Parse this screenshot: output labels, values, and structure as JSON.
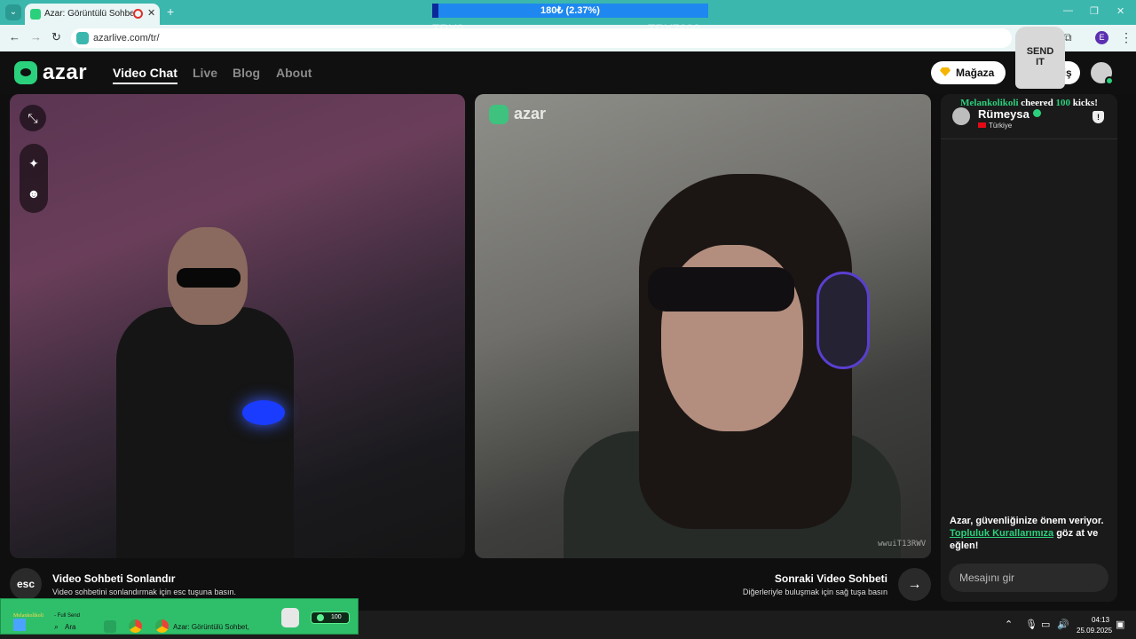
{
  "browser": {
    "tab_title": "Azar: Görüntülü Sohbet, Ar",
    "url": "azarlive.com/tr/",
    "profile_initial": "E"
  },
  "overlay": {
    "progress_text": "180₺ (2.37%)",
    "progress_fraction": 0.0237,
    "left_label": "TRY0",
    "right_label": "TRY7600"
  },
  "site": {
    "logo": "azar",
    "nav": [
      {
        "label": "Video Chat",
        "active": true
      },
      {
        "label": "Live",
        "active": false
      },
      {
        "label": "Blog",
        "active": false
      },
      {
        "label": "About",
        "active": false
      }
    ],
    "shop_label": "Mağaza",
    "premium_label_partial": "miş"
  },
  "sticker": {
    "line1": "SEND",
    "line2": "IT"
  },
  "video": {
    "watermark": "azar",
    "partner_id": "wwuiT13RWV"
  },
  "chat": {
    "cheer_name": "Melankolikoli",
    "cheer_text": "cheered",
    "cheer_amount": "100",
    "cheer_suffix": "kicks!",
    "partner_name": "Rümeysa",
    "partner_country": "Türkiye",
    "safety_before": "Azar, güvenliğinize önem veriyor. ",
    "safety_link": "Topluluk Kurallarımıza",
    "safety_after": " göz at ve eğlen!",
    "input_placeholder": "Mesajını gir"
  },
  "controls": {
    "esc_label": "esc",
    "end_title": "Video Sohbeti Sonlandır",
    "end_sub": "Video sohbetini sonlandırmak için esc tuşuna basın.",
    "next_title": "Sonraki Video Sohbeti",
    "next_sub": "Diğerleriyle buluşmak için sağ tuşa basın"
  },
  "taskbar": {
    "kick_name": "Melankolikoli",
    "kick_send": "- Full Send",
    "search_label": "Ara",
    "window_title": "Azar: Görüntülü Sohbet,",
    "kick_count": "100",
    "time": "04:13",
    "date": "25.09.2025"
  },
  "colors": {
    "brand": "#2bd07c",
    "browser_chrome": "#3cb7ae"
  }
}
